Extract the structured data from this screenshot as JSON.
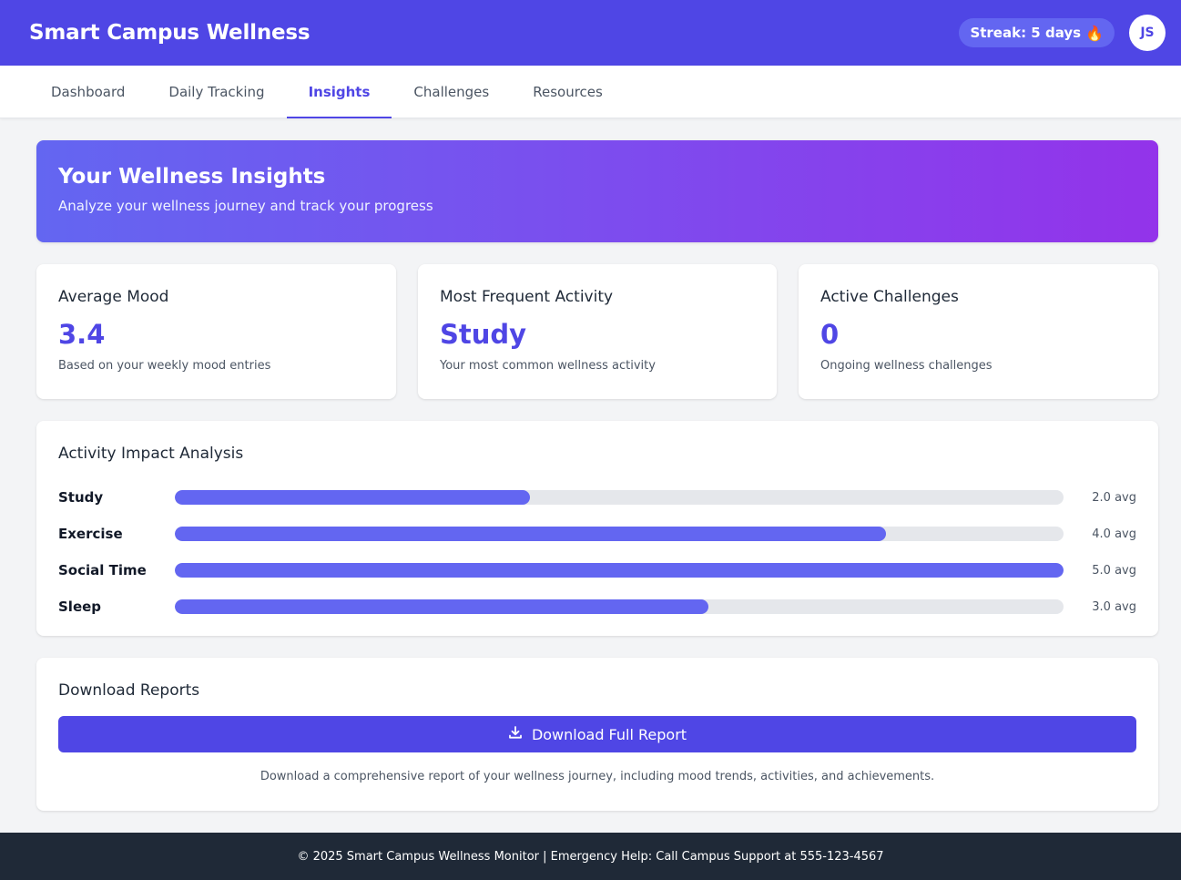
{
  "app": {
    "title": "Smart Campus Wellness"
  },
  "header": {
    "streak_label": "Streak: 5 days",
    "streak_icon": "fire-icon",
    "avatar_initials": "JS"
  },
  "tabs": [
    {
      "label": "Dashboard",
      "active": false
    },
    {
      "label": "Daily Tracking",
      "active": false
    },
    {
      "label": "Insights",
      "active": true
    },
    {
      "label": "Challenges",
      "active": false
    },
    {
      "label": "Resources",
      "active": false
    }
  ],
  "hero": {
    "title": "Your Wellness Insights",
    "subtitle": "Analyze your wellness journey and track your progress"
  },
  "stats": [
    {
      "title": "Average Mood",
      "value": "3.4",
      "description": "Based on your weekly mood entries"
    },
    {
      "title": "Most Frequent Activity",
      "value": "Study",
      "description": "Your most common wellness activity"
    },
    {
      "title": "Active Challenges",
      "value": "0",
      "description": "Ongoing wellness challenges"
    }
  ],
  "activity": {
    "title": "Activity Impact Analysis",
    "max": 5,
    "items": [
      {
        "label": "Study",
        "value": 2.0,
        "value_text": "2.0 avg"
      },
      {
        "label": "Exercise",
        "value": 4.0,
        "value_text": "4.0 avg"
      },
      {
        "label": "Social Time",
        "value": 5.0,
        "value_text": "5.0 avg"
      },
      {
        "label": "Sleep",
        "value": 3.0,
        "value_text": "3.0 avg"
      }
    ]
  },
  "download": {
    "title": "Download Reports",
    "button_label": "Download Full Report",
    "button_icon": "download-icon",
    "note": "Download a comprehensive report of your wellness journey, including mood trends, activities, and achievements."
  },
  "footer": {
    "text": "© 2025 Smart Campus Wellness Monitor | Emergency Help: Call Campus Support at 555-123-4567"
  },
  "colors": {
    "primary": "#4f46e5",
    "bar": "#6366f1",
    "gradient_end": "#9333ea",
    "footer": "#1f2937"
  }
}
